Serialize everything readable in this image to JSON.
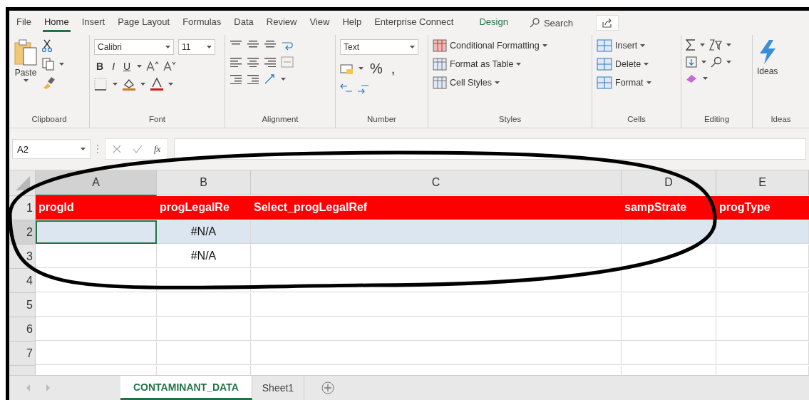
{
  "menu_tabs": [
    {
      "label": "File",
      "selected": false,
      "kind": "normal"
    },
    {
      "label": "Home",
      "selected": true,
      "kind": "normal"
    },
    {
      "label": "Insert",
      "selected": false,
      "kind": "normal"
    },
    {
      "label": "Page Layout",
      "selected": false,
      "kind": "normal"
    },
    {
      "label": "Formulas",
      "selected": false,
      "kind": "normal"
    },
    {
      "label": "Data",
      "selected": false,
      "kind": "normal"
    },
    {
      "label": "Review",
      "selected": false,
      "kind": "normal"
    },
    {
      "label": "View",
      "selected": false,
      "kind": "normal"
    },
    {
      "label": "Help",
      "selected": false,
      "kind": "normal"
    },
    {
      "label": "Enterprise Connect",
      "selected": false,
      "kind": "normal"
    },
    {
      "label": "Design",
      "selected": false,
      "kind": "contextual"
    }
  ],
  "search": {
    "placeholder": "Search"
  },
  "ribbon": {
    "clipboard": {
      "paste": "Paste",
      "group": "Clipboard"
    },
    "font": {
      "name": "Calibri",
      "size": "11",
      "style_buttons": [
        "B",
        "I",
        "U"
      ],
      "group": "Font"
    },
    "alignment": {
      "group": "Alignment"
    },
    "number": {
      "format": "Text",
      "symbols": [
        "%",
        ","
      ],
      "group": "Number"
    },
    "styles": {
      "buttons": [
        "Conditional Formatting",
        "Format as Table",
        "Cell Styles"
      ],
      "group": "Styles"
    },
    "cells": {
      "buttons": [
        "Insert",
        "Delete",
        "Format"
      ],
      "group": "Cells"
    },
    "editing": {
      "group": "Editing"
    },
    "ideas": {
      "button": "Ideas",
      "group": "Ideas"
    }
  },
  "formula_bar": {
    "name_box": "A2",
    "fx": "fx"
  },
  "sheet": {
    "columns": [
      {
        "label": "A",
        "selected": true
      },
      {
        "label": "B",
        "selected": false
      },
      {
        "label": "C",
        "selected": false
      },
      {
        "label": "D",
        "selected": false
      },
      {
        "label": "E",
        "selected": false
      }
    ],
    "rows": [
      {
        "number": "1",
        "kind": "header",
        "selected": false,
        "cells": [
          "progId",
          "progLegalRe",
          "Select_progLegalRef",
          "sampStrate",
          "progType"
        ]
      },
      {
        "number": "2",
        "kind": "data",
        "selected": true,
        "cells": [
          "",
          "#N/A",
          "",
          "",
          ""
        ]
      },
      {
        "number": "3",
        "kind": "data",
        "selected": false,
        "cells": [
          "",
          "#N/A",
          "",
          "",
          ""
        ]
      },
      {
        "number": "4",
        "kind": "data",
        "selected": false,
        "cells": [
          "",
          "",
          "",
          "",
          ""
        ]
      },
      {
        "number": "5",
        "kind": "data",
        "selected": false,
        "cells": [
          "",
          "",
          "",
          "",
          ""
        ]
      },
      {
        "number": "6",
        "kind": "data",
        "selected": false,
        "cells": [
          "",
          "",
          "",
          "",
          ""
        ]
      },
      {
        "number": "7",
        "kind": "data",
        "selected": false,
        "cells": [
          "",
          "",
          "",
          "",
          ""
        ]
      }
    ]
  },
  "sheet_tabs": [
    {
      "label": "CONTAMINANT_DATA",
      "selected": true
    },
    {
      "label": "Sheet1",
      "selected": false
    }
  ]
}
